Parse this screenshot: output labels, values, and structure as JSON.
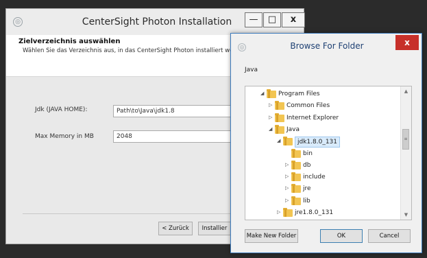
{
  "installer": {
    "title": "CenterSight Photon Installation",
    "minimize_glyph": "—",
    "maximize_glyph": "□",
    "close_glyph": "x",
    "heading": "Zielverzeichnis auswählen",
    "subheading": "Wählen Sie das Verzeichnis aus, in das CenterSight Photon installiert werd",
    "jdk_label": "Jdk (JAVA HOME):",
    "jdk_value": "Path\\to\\Java\\jdk1.8",
    "memory_label": "Max Memory in MB",
    "memory_value": "2048",
    "back_button": "< Zurück",
    "install_button": "Installier"
  },
  "dialog": {
    "title": "Browse For Folder",
    "close_glyph": "x",
    "description": "Java",
    "tree": [
      {
        "label": "Program Files",
        "arrow": "◢",
        "depth": 0
      },
      {
        "label": "Common Files",
        "arrow": "▷",
        "depth": 1
      },
      {
        "label": "Internet Explorer",
        "arrow": "▷",
        "depth": 1
      },
      {
        "label": "Java",
        "arrow": "◢",
        "depth": 1
      },
      {
        "label": "jdk1.8.0_131",
        "arrow": "◢",
        "depth": 2,
        "selected": true
      },
      {
        "label": "bin",
        "arrow": "",
        "depth": 3
      },
      {
        "label": "db",
        "arrow": "▷",
        "depth": 3
      },
      {
        "label": "include",
        "arrow": "▷",
        "depth": 3
      },
      {
        "label": "jre",
        "arrow": "▷",
        "depth": 3
      },
      {
        "label": "lib",
        "arrow": "▷",
        "depth": 3
      },
      {
        "label": "jre1.8.0_131",
        "arrow": "▷",
        "depth": 2
      }
    ],
    "make_new_folder_button": "Make New Folder",
    "ok_button": "OK",
    "cancel_button": "Cancel"
  },
  "icons": {
    "app_icon": "installer-app-icon",
    "folder_icon": "folder-icon"
  },
  "colors": {
    "dialog_title": "#1d3f72",
    "close_red": "#c7302a",
    "folder_yellow": "#f2c552",
    "selection": "#d9ebfb"
  }
}
